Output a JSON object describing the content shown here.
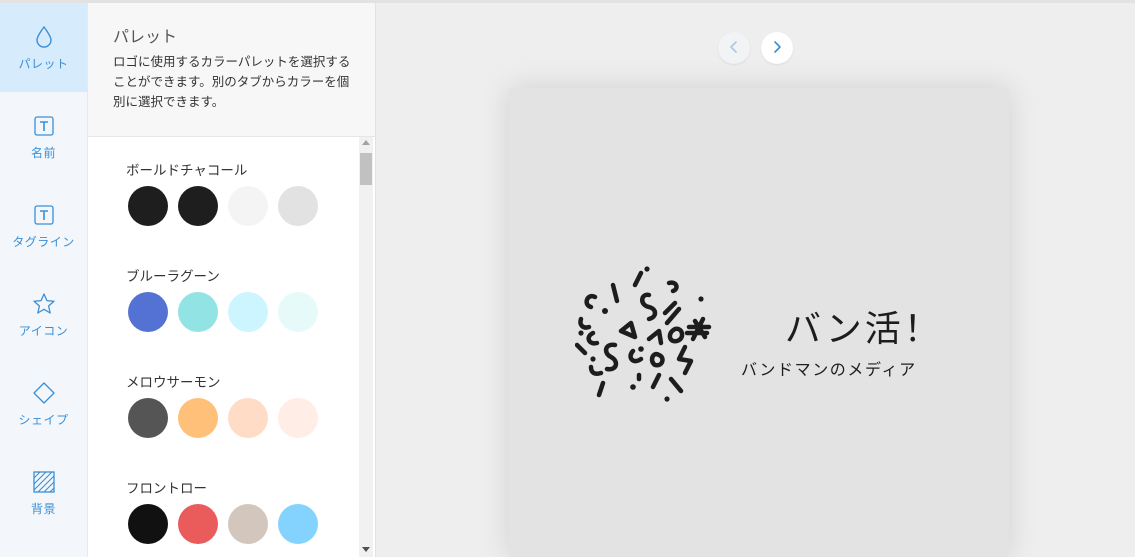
{
  "sidebar": {
    "items": [
      {
        "label": "パレット",
        "icon": "drop-icon",
        "active": true
      },
      {
        "label": "名前",
        "icon": "text-icon"
      },
      {
        "label": "タグライン",
        "icon": "text-icon"
      },
      {
        "label": "アイコン",
        "icon": "star-icon"
      },
      {
        "label": "シェイプ",
        "icon": "diamond-icon"
      },
      {
        "label": "背景",
        "icon": "hatch-icon"
      }
    ],
    "accent_color": "#3a8fd6"
  },
  "panel": {
    "title": "パレット",
    "description": "ロゴに使用するカラーパレットを選択することができます。別のタブからカラーを個別に選択できます。",
    "palettes": [
      {
        "name": "ボールドチャコール",
        "colors": [
          "#1e1e1e",
          "#1e1e1e",
          "#f4f4f4",
          "#e2e2e2"
        ]
      },
      {
        "name": "ブルーラグーン",
        "colors": [
          "#5472d3",
          "#92e3e3",
          "#ccf5ff",
          "#e6fafa"
        ]
      },
      {
        "name": "メロウサーモン",
        "colors": [
          "#555555",
          "#ffc07a",
          "#ffdcc5",
          "#ffede6"
        ]
      },
      {
        "name": "フロントロー",
        "colors": [
          "#111111",
          "#ea5b5b",
          "#d3c7bd",
          "#84d3ff"
        ]
      }
    ]
  },
  "nav": {
    "prev_icon": "chevron-left-icon",
    "next_icon": "chevron-right-icon"
  },
  "preview": {
    "logo_name": "バン活！",
    "tagline": "バンドマンのメディア",
    "logo_icon": "confetti-doodle-icon",
    "background_color": "#e3e3e3"
  }
}
